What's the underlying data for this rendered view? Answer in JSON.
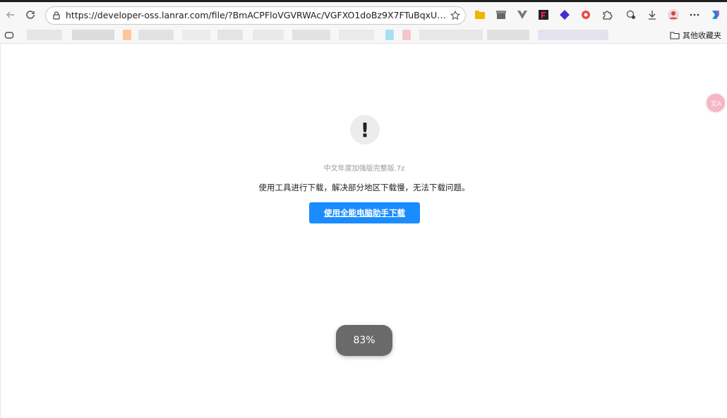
{
  "browser": {
    "url": "https://developer-oss.lanrar.com/file/?BmACPFloVGVRWAc/VGFXO1doBz9X7FTuBqxUtFWfUNYJ7AboD...",
    "other_bookmarks": "其他收藏夹",
    "colors": {
      "toolbar": "#f7f7f7",
      "accent": "#1a8cff"
    }
  },
  "page": {
    "warning_icon": "!",
    "filename": "中文年度加强版完整版.7z",
    "message": "使用工具进行下载，解决部分地区下载慢，无法下载问题。",
    "download_button": "使用全能电脑助手下载",
    "progress": "83%",
    "progress_value": 83
  }
}
